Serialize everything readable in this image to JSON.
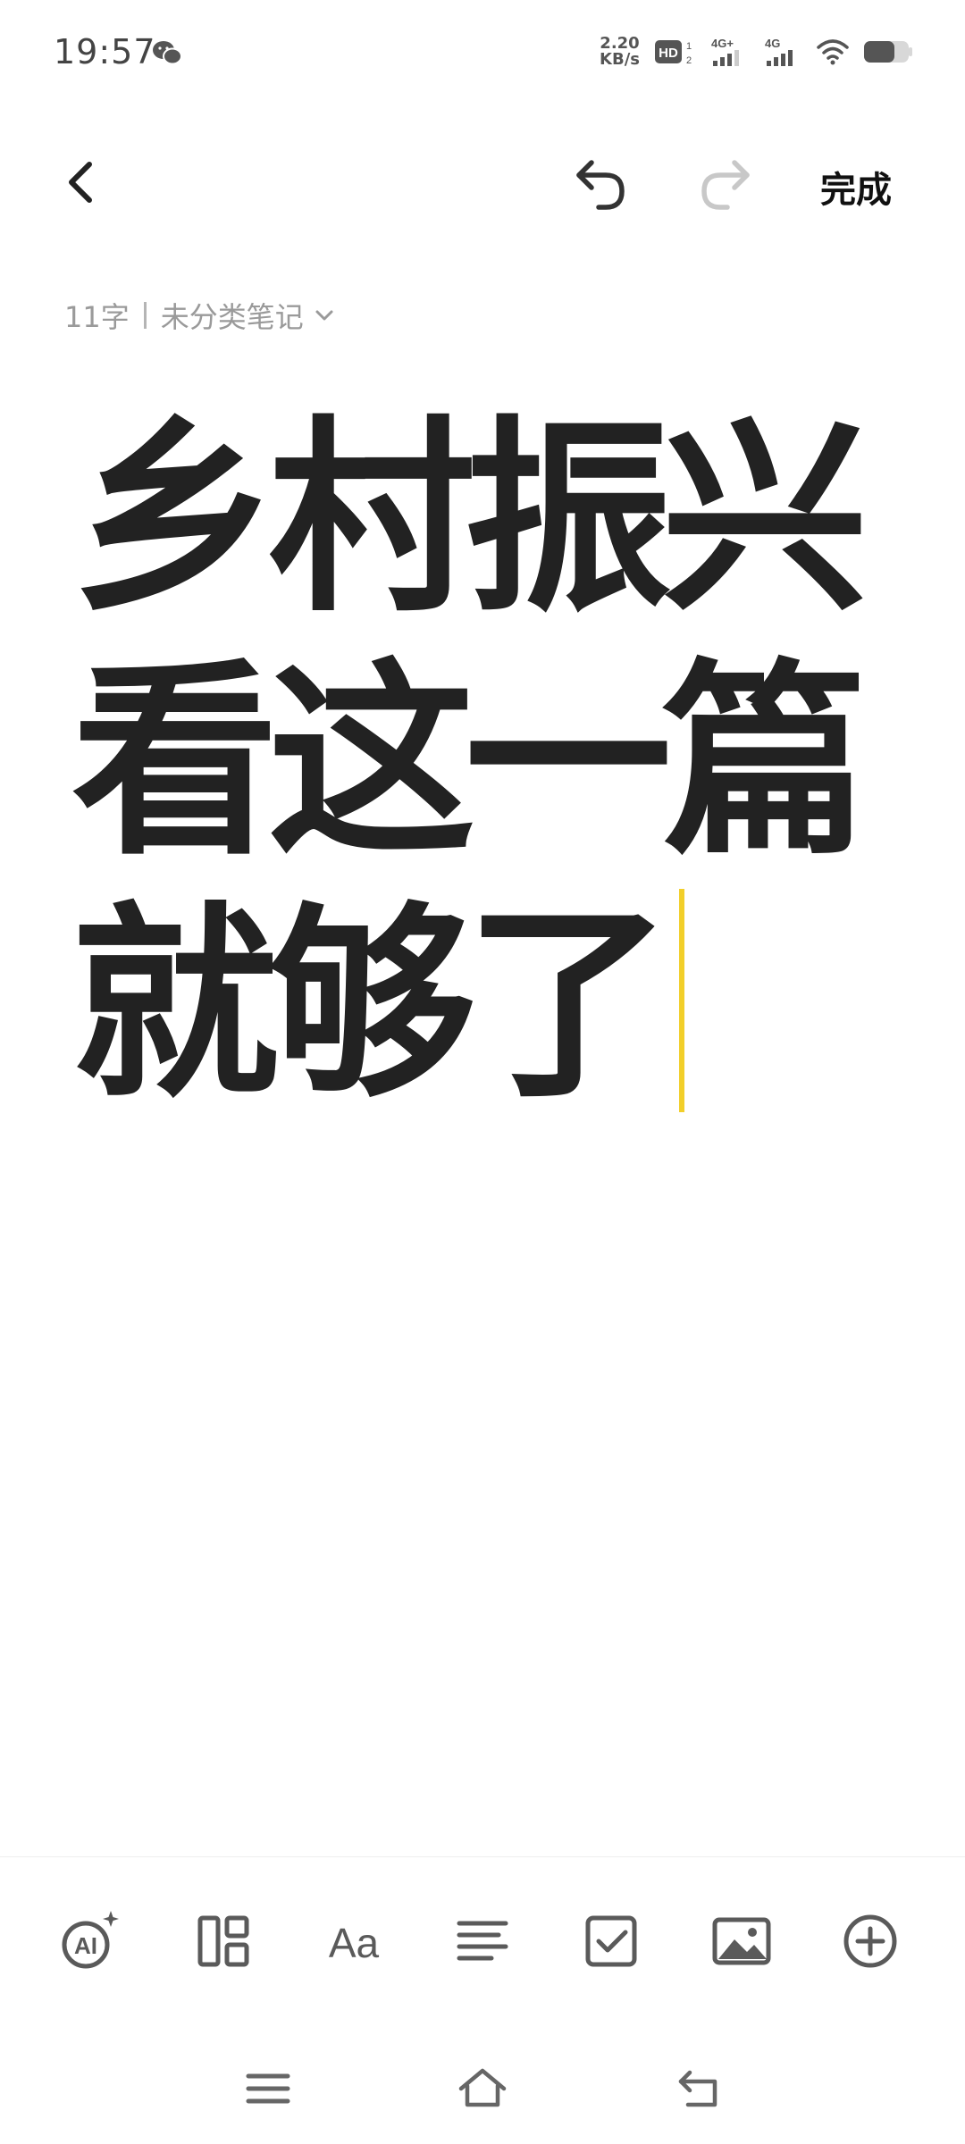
{
  "status_bar": {
    "time": "19:57",
    "net_speed_value": "2.20",
    "net_speed_unit": "KB/s",
    "icons": [
      "wechat-icon",
      "hd-icon",
      "signal-4g-plus-icon",
      "signal-4g-icon",
      "wifi-icon",
      "battery-icon"
    ]
  },
  "top_bar": {
    "done_label": "完成",
    "icons": [
      "back-icon",
      "undo-icon",
      "redo-icon"
    ]
  },
  "meta": {
    "word_count": "11字",
    "category": "未分类笔记"
  },
  "editor": {
    "lines": [
      "乡村振兴",
      "看这一篇",
      "就够了"
    ]
  },
  "toolbar": {
    "items": [
      "ai-assistant-icon",
      "layout-icon",
      "text-format-icon",
      "align-icon",
      "checklist-icon",
      "image-icon",
      "add-icon"
    ]
  },
  "nav": {
    "items": [
      "menu-icon",
      "home-icon",
      "back-icon"
    ]
  },
  "colors": {
    "text": "#222222",
    "caret": "#f2cf2a",
    "meta": "#9a9a9a",
    "icon": "#5a5a5a",
    "disabled": "#c8c8c8"
  }
}
